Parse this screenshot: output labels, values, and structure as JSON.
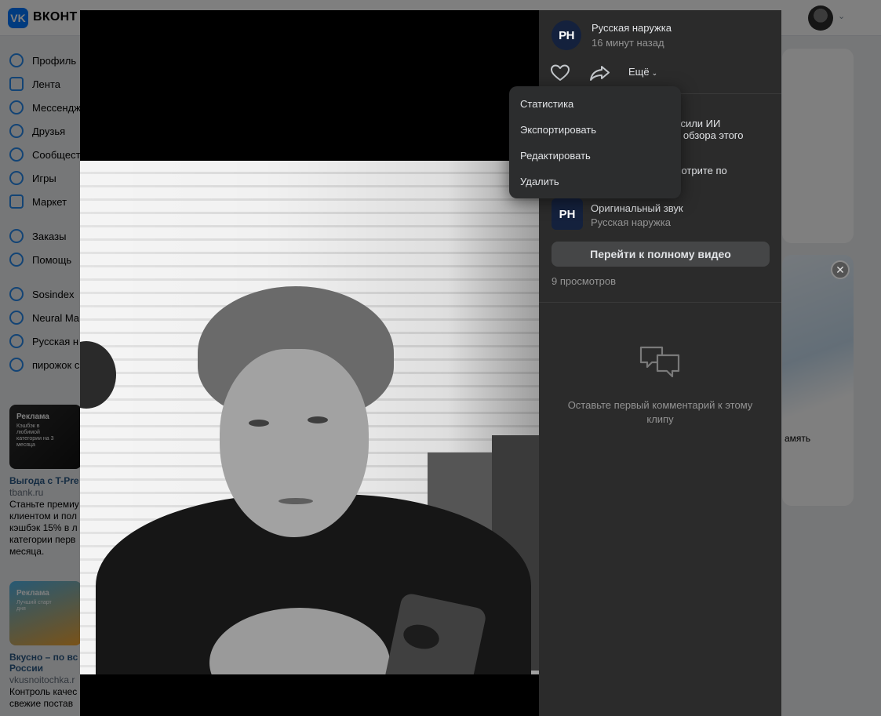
{
  "background": {
    "logo": {
      "letter": "VK",
      "text": "ВКОНТ"
    },
    "nav": [
      {
        "label": "Профиль",
        "icon": "profile-icon"
      },
      {
        "label": "Лента",
        "icon": "feed-icon"
      },
      {
        "label": "Мессендж",
        "icon": "messenger-icon"
      },
      {
        "label": "Друзья",
        "icon": "friends-icon"
      },
      {
        "label": "Сообщест",
        "icon": "communities-icon"
      },
      {
        "label": "Игры",
        "icon": "games-icon"
      },
      {
        "label": "Маркет",
        "icon": "market-icon"
      }
    ],
    "nav2": [
      {
        "label": "Заказы",
        "icon": "orders-icon"
      },
      {
        "label": "Помощь",
        "icon": "help-icon"
      }
    ],
    "nav3": [
      {
        "label": "Sosindex",
        "icon": "group-icon"
      },
      {
        "label": "Neural Ma",
        "icon": "group-icon"
      },
      {
        "label": "Русская н",
        "icon": "group-icon"
      },
      {
        "label": "пирожок с",
        "icon": "group-icon"
      }
    ],
    "ads": [
      {
        "tag": "Реклама",
        "sub": "Кэшбэк в любимой категории на 3 месяца",
        "title": "Выгода с T-Pre",
        "domain": "tbank.ru",
        "desc": [
          "Станьте премиу",
          "клиентом и пол",
          "кэшбэк 15% в л",
          "категории перв",
          "месяца."
        ]
      },
      {
        "tag": "Реклама",
        "sub": "Лучший старт дня",
        "title": "Вкусно – по вс",
        "title2": "России",
        "domain": "vkusnoitochka.r",
        "desc": [
          "Контроль качес",
          "свежие постав"
        ]
      }
    ],
    "right_text": "амять"
  },
  "post": {
    "author": "Русская наружка",
    "author_initials": "PH",
    "time": "16 минут назад",
    "more_label": "Ещё",
    "description_lines": [
      "о",
      "росили ИИ",
      "ия обзора этого",
      "",
      "смотрите по"
    ],
    "sound_title": "Оригинальный звук",
    "sound_author": "Русская наружка",
    "full_video_label": "Перейти к полному видео",
    "views": "9 просмотров",
    "empty_comments": "Оставьте первый комментарий к этому клипу"
  },
  "menu": {
    "items": [
      {
        "label": "Статистика",
        "name": "menu-item-statistics"
      },
      {
        "label": "Экспортировать",
        "name": "menu-item-export"
      },
      {
        "label": "Редактировать",
        "name": "menu-item-edit"
      },
      {
        "label": "Удалить",
        "name": "menu-item-delete"
      }
    ]
  },
  "colors": {
    "accent": "#2688eb",
    "panel": "#2b2b2b",
    "menu": "#2c2d2e",
    "button": "#454647"
  }
}
